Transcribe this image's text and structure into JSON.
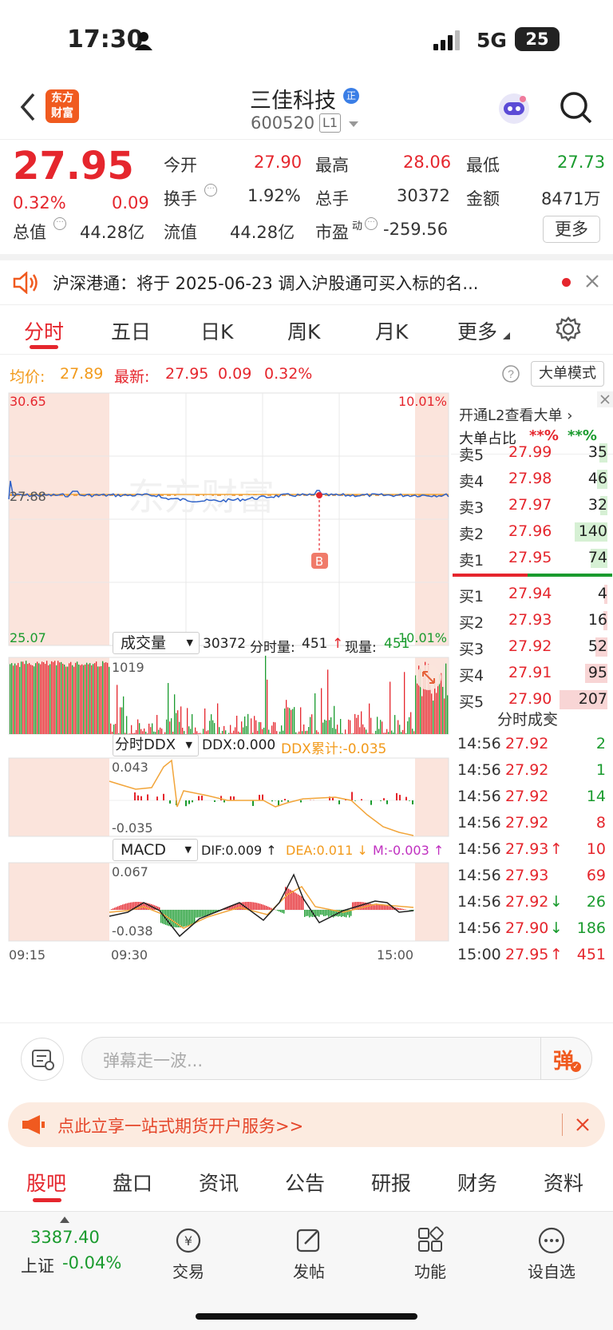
{
  "status": {
    "time": "17:30",
    "network": "5G",
    "battery": "25"
  },
  "nav": {
    "brand_line1": "东方",
    "brand_line2": "财富",
    "title": "三佳科技",
    "title_badge": "正",
    "code": "600520",
    "level": "L1"
  },
  "quote": {
    "price": "27.95",
    "change_pct": "0.32%",
    "change": "0.09",
    "open_label": "今开",
    "open": "27.90",
    "high_label": "最高",
    "high": "28.06",
    "low_label": "最低",
    "low": "27.73",
    "turnover_label": "换手",
    "turnover": "1.92%",
    "volume_label": "总手",
    "volume": "30372",
    "amount_label": "金额",
    "amount": "8471万",
    "mcap_label": "总值",
    "mcap": "44.28亿",
    "float_label": "流值",
    "float": "44.28亿",
    "pe_label": "市盈",
    "pe_sup": "动",
    "pe": "-259.56",
    "more": "更多"
  },
  "notice": {
    "text": "沪深港通：将于 2025-06-23 调入沪股通可买入标的名..."
  },
  "tabs": [
    "分时",
    "五日",
    "日K",
    "周K",
    "月K",
    "更多"
  ],
  "avg": {
    "avg_label": "均价:",
    "avg_value": "27.89",
    "latest_label": "最新:",
    "latest_value": "27.95",
    "change": "0.09",
    "change_pct": "0.32%",
    "bigorder_button": "大单模式"
  },
  "chart": {
    "price_top": "30.65",
    "price_mid": "27.88",
    "price_bottom": "25.07",
    "pct_top": "10.01%",
    "pct_bottom": "-10.01%",
    "watermark": "东方财富",
    "buy_marker": "B",
    "vol_selector": "成交量",
    "vol_info_total": "30372",
    "vol_info_label1": "分时量:",
    "vol_info_min": "451",
    "vol_info_label2": "现量:",
    "vol_info_now": "451",
    "vol_axis_top": "1019",
    "ddx_selector": "分时DDX",
    "ddx_value": "DDX:0.000",
    "ddx_cum": "DDX累计:-0.035",
    "ddx_top": "0.043",
    "ddx_bottom": "-0.035",
    "macd_selector": "MACD",
    "dif": "DIF:0.009",
    "dea": "DEA:0.011",
    "m": "M:-0.003",
    "macd_top": "0.067",
    "macd_bottom": "-0.038",
    "time_start": "09:15",
    "time_mid": "09:30",
    "time_end": "15:00"
  },
  "book": {
    "l2_link": "开通L2查看大单",
    "ratio_label": "大单占比",
    "ratio_red": "**%",
    "ratio_green": "**%",
    "asks": [
      {
        "label": "卖5",
        "price": "27.99",
        "qty": "35"
      },
      {
        "label": "卖4",
        "price": "27.98",
        "qty": "46"
      },
      {
        "label": "卖3",
        "price": "27.97",
        "qty": "32"
      },
      {
        "label": "卖2",
        "price": "27.96",
        "qty": "140"
      },
      {
        "label": "卖1",
        "price": "27.95",
        "qty": "74"
      }
    ],
    "bids": [
      {
        "label": "买1",
        "price": "27.94",
        "qty": "4"
      },
      {
        "label": "买2",
        "price": "27.93",
        "qty": "16"
      },
      {
        "label": "买3",
        "price": "27.92",
        "qty": "52"
      },
      {
        "label": "买4",
        "price": "27.91",
        "qty": "95"
      },
      {
        "label": "买5",
        "price": "27.90",
        "qty": "207"
      }
    ],
    "ticks_title": "分时成交",
    "ticks": [
      {
        "time": "14:56",
        "price": "27.92",
        "arrow": "",
        "qty": "2",
        "side": "g"
      },
      {
        "time": "14:56",
        "price": "27.92",
        "arrow": "",
        "qty": "1",
        "side": "g"
      },
      {
        "time": "14:56",
        "price": "27.92",
        "arrow": "",
        "qty": "14",
        "side": "g"
      },
      {
        "time": "14:56",
        "price": "27.92",
        "arrow": "",
        "qty": "8",
        "side": "r"
      },
      {
        "time": "14:56",
        "price": "27.93",
        "arrow": "↑",
        "qty": "10",
        "side": "r"
      },
      {
        "time": "14:56",
        "price": "27.93",
        "arrow": "",
        "qty": "69",
        "side": "r"
      },
      {
        "time": "14:56",
        "price": "27.92",
        "arrow": "↓",
        "qty": "26",
        "side": "g"
      },
      {
        "time": "14:56",
        "price": "27.90",
        "arrow": "↓",
        "qty": "186",
        "side": "g"
      },
      {
        "time": "15:00",
        "price": "27.95",
        "arrow": "↑",
        "qty": "451",
        "side": "r"
      }
    ]
  },
  "input": {
    "placeholder": "弹幕走一波...",
    "danmu": "弹"
  },
  "ad": {
    "text": "点此立享一站式期货开户服务>>"
  },
  "bottom_tabs": [
    "股吧",
    "盘口",
    "资讯",
    "公告",
    "研报",
    "财务",
    "资料"
  ],
  "dock": {
    "index_value": "3387.40",
    "index_name": "上证",
    "index_change": "-0.04%",
    "trade": "交易",
    "post": "发帖",
    "func": "功能",
    "watch": "设自选"
  }
}
